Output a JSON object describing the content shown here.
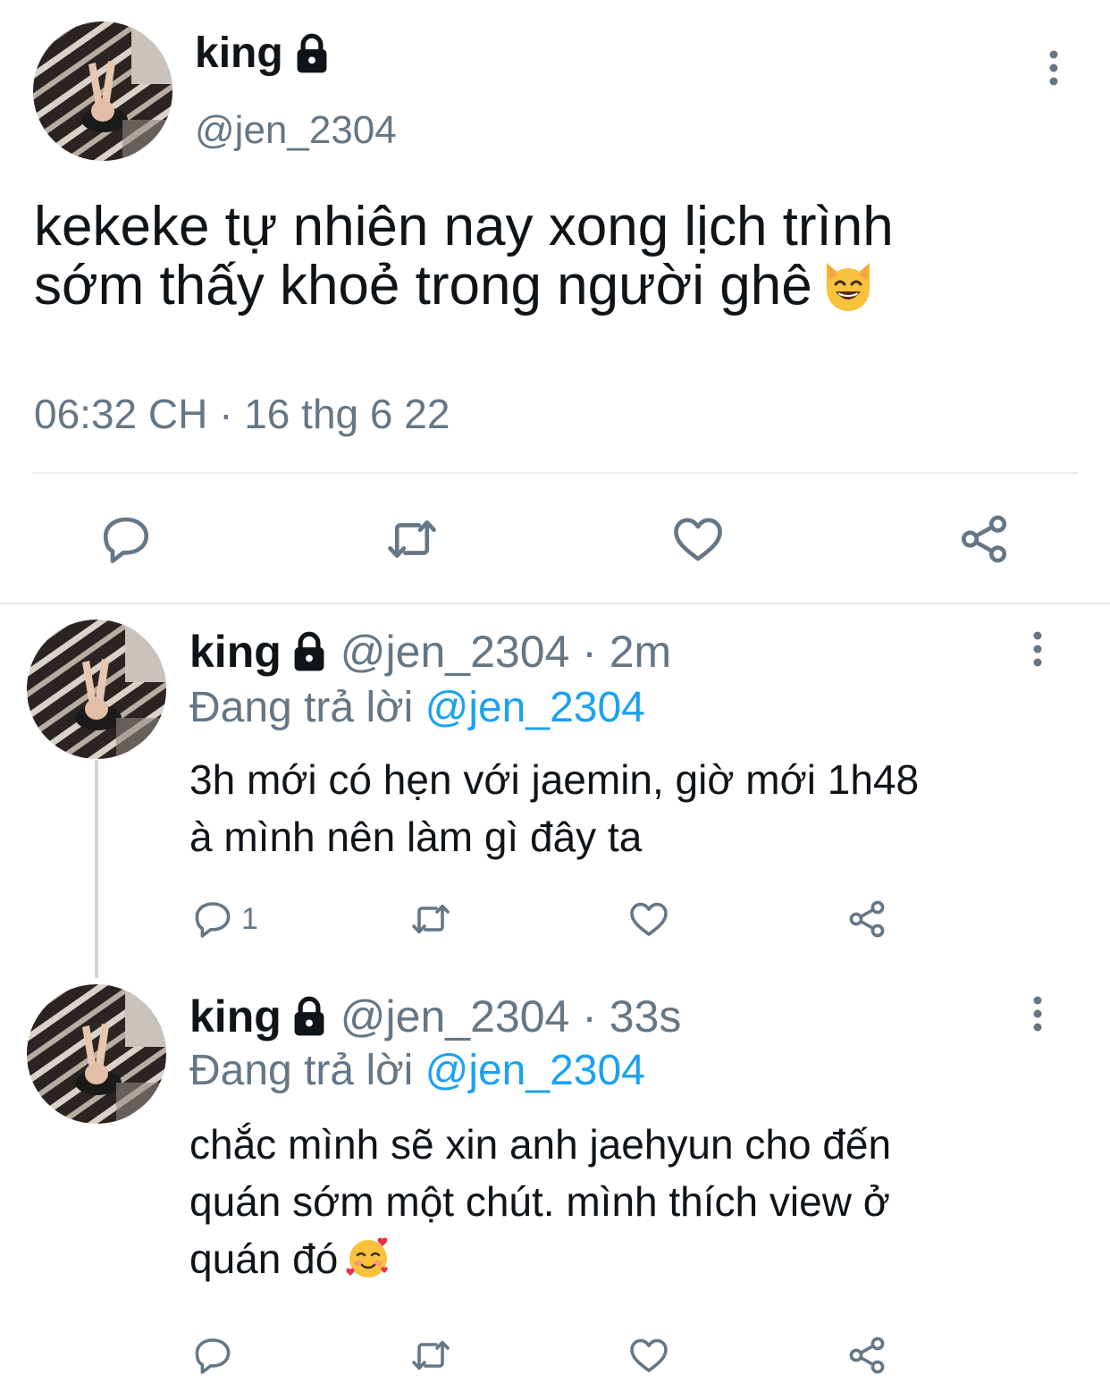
{
  "colors": {
    "text": "#0f1419",
    "secondary": "#657786",
    "link": "#1da1f2",
    "divider": "#e6ecf0"
  },
  "main_tweet": {
    "name": "king",
    "handle": "@jen_2304",
    "text_line1": "kekeke tự nhiên nay xong lịch trình",
    "text_line2": "sớm thấy khoẻ trong người ghê",
    "emoji": "smiling-cat-emoji",
    "timestamp": "06:32 CH · 16 thg 6 22",
    "actions": [
      "reply-icon",
      "retweet-icon",
      "like-icon",
      "share-icon"
    ]
  },
  "replies": [
    {
      "name": "king",
      "handle_time": "@jen_2304 · 2m",
      "replying_label": "Đang trả lời",
      "replying_to": "@jen_2304",
      "text_line1": "3h mới có hẹn với jaemin, giờ mới 1h48",
      "text_line2": "à mình nên làm gì đây ta",
      "reply_count": "1"
    },
    {
      "name": "king",
      "handle_time": "@jen_2304 · 33s",
      "replying_label": "Đang trả lời",
      "replying_to": "@jen_2304",
      "text_line1": "chắc mình sẽ xin anh jaehyun cho đến",
      "text_line2": "quán sớm một chút. mình thích view ở",
      "text_line3": "quán đó",
      "emoji": "smiling-face-with-hearts-emoji"
    }
  ]
}
